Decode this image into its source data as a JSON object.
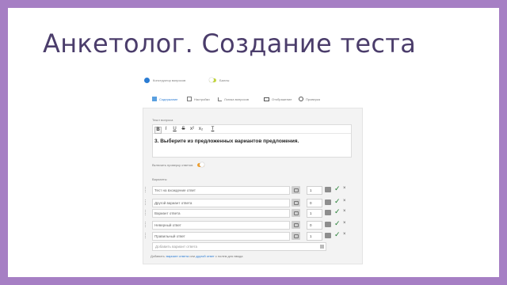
{
  "slide": {
    "title": "Анкетолог. Создание теста"
  },
  "topbar": {
    "question_label": "Конструктор вопросов",
    "toggle_label": "Баллы"
  },
  "tabs": [
    {
      "label": "Содержание",
      "icon": "list-icon",
      "active": true
    },
    {
      "label": "Настройки",
      "icon": "grid-icon",
      "active": false
    },
    {
      "label": "Логика вопросов",
      "icon": "branch-icon",
      "active": false
    },
    {
      "label": "Отображение",
      "icon": "monitor-icon",
      "active": false
    },
    {
      "label": "Проверка",
      "icon": "gear-icon",
      "active": false
    }
  ],
  "question": {
    "label": "Текст вопроса",
    "toolbar": [
      "B",
      "I",
      "U",
      "S",
      "x²",
      "x₂",
      "T"
    ],
    "text": "3. Выберите из предложенных вариантов предложения."
  },
  "option_toggle_label": "Включить проверку ответов",
  "answers_label": "Варианты",
  "answers": [
    {
      "text": "Тест на вхождение ответ",
      "score": "1"
    },
    {
      "text": "Другой вариант ответа",
      "score": "0"
    },
    {
      "text": "Вариант ответа",
      "score": "1"
    },
    {
      "text": "Неверный ответ",
      "score": "0"
    },
    {
      "text": "Правильный ответ",
      "score": "1"
    }
  ],
  "add_answer_placeholder": "Добавить вариант ответа",
  "footer": {
    "prefix": "Добавить: ",
    "link1": "вариант ответа",
    "middle": " или ",
    "link2": "другой ответ",
    "suffix": " с полем для ввода"
  },
  "colors": {
    "frame": "#a67fc4",
    "title": "#4b3d6b",
    "accent": "#2b7cd3"
  }
}
